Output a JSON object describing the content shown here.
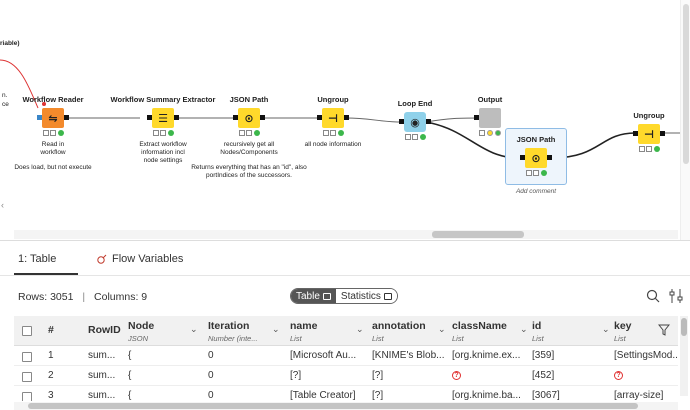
{
  "canvas": {
    "partial_label": "riable)",
    "partial_label_2": "n.",
    "partial_label_3": "ce",
    "add_comment": "Add comment",
    "nodes": [
      {
        "key": "workflow_reader",
        "title": "Workflow Reader",
        "desc": "Read in\nworkflow",
        "note": "Does load, but not execute",
        "color": "orange",
        "icon": "workflow-reader-icon",
        "glyph": "⇋"
      },
      {
        "key": "workflow_summary",
        "title": "Workflow Summary Extractor",
        "desc": "Extract workflow\ninformation incl\nnode settings",
        "color": "yellow",
        "icon": "summary-extractor-icon",
        "glyph": "☰"
      },
      {
        "key": "json_path_1",
        "title": "JSON Path",
        "desc": "recursively get all\nNodes/Components",
        "note": "Returns everything that has an \"id\", also\nportIndices of the successors.",
        "color": "yellow",
        "icon": "json-path-icon",
        "glyph": "⊙"
      },
      {
        "key": "ungroup_1",
        "title": "Ungroup",
        "desc": "all node information",
        "color": "yellow",
        "icon": "ungroup-icon",
        "glyph": "⊣"
      },
      {
        "key": "loop_end",
        "title": "Loop End",
        "desc": "",
        "color": "loop",
        "icon": "loop-end-icon",
        "glyph": "◉"
      },
      {
        "key": "output",
        "title": "Output",
        "desc": "",
        "color": "grey",
        "icon": "output-icon",
        "glyph": ""
      },
      {
        "key": "json_path_2",
        "title": "JSON Path",
        "desc": "",
        "color": "yellow",
        "icon": "json-path-icon",
        "glyph": "⊙"
      },
      {
        "key": "ungroup_2",
        "title": "Ungroup",
        "desc": "",
        "color": "yellow",
        "icon": "ungroup-icon",
        "glyph": "⊣"
      }
    ]
  },
  "panel": {
    "tabs": [
      {
        "label": "1: Table",
        "active": true
      },
      {
        "label": "Flow Variables",
        "active": false
      }
    ],
    "rows_label": "Rows: 3051",
    "separator": "|",
    "cols_label": "Columns: 9",
    "view_toggle": {
      "table": "Table",
      "statistics": "Statistics"
    },
    "table": {
      "columns": [
        {
          "name": "#",
          "type": ""
        },
        {
          "name": "RowID",
          "type": ""
        },
        {
          "name": "Node",
          "type": "JSON"
        },
        {
          "name": "Iteration",
          "type": "Number (inte..."
        },
        {
          "name": "name",
          "type": "List"
        },
        {
          "name": "annotation",
          "type": "List"
        },
        {
          "name": "className",
          "type": "List"
        },
        {
          "name": "id",
          "type": "List"
        },
        {
          "name": "key",
          "type": "List"
        }
      ],
      "rows": [
        [
          "1",
          "sum...",
          "{",
          "0",
          "[Microsoft Au...",
          "[KNIME's Blob...",
          "[org.knime.ex...",
          "[359]",
          "[SettingsMod..."
        ],
        [
          "2",
          "sum...",
          "{",
          "0",
          "[?]",
          "[?]",
          "?",
          "[452]",
          "?"
        ],
        [
          "3",
          "sum...",
          "{",
          "0",
          "[Table Creator]",
          "[?]",
          "[org.knime.ba...",
          "[3067]",
          "[array-size]"
        ]
      ]
    }
  },
  "colors": {
    "orange": "#f38a2c",
    "yellow": "#ffd92b",
    "loop": "#8fd1ea",
    "grey": "#bdbdbd",
    "selection": "#8fbce5",
    "status_green": "#3cb74b"
  }
}
